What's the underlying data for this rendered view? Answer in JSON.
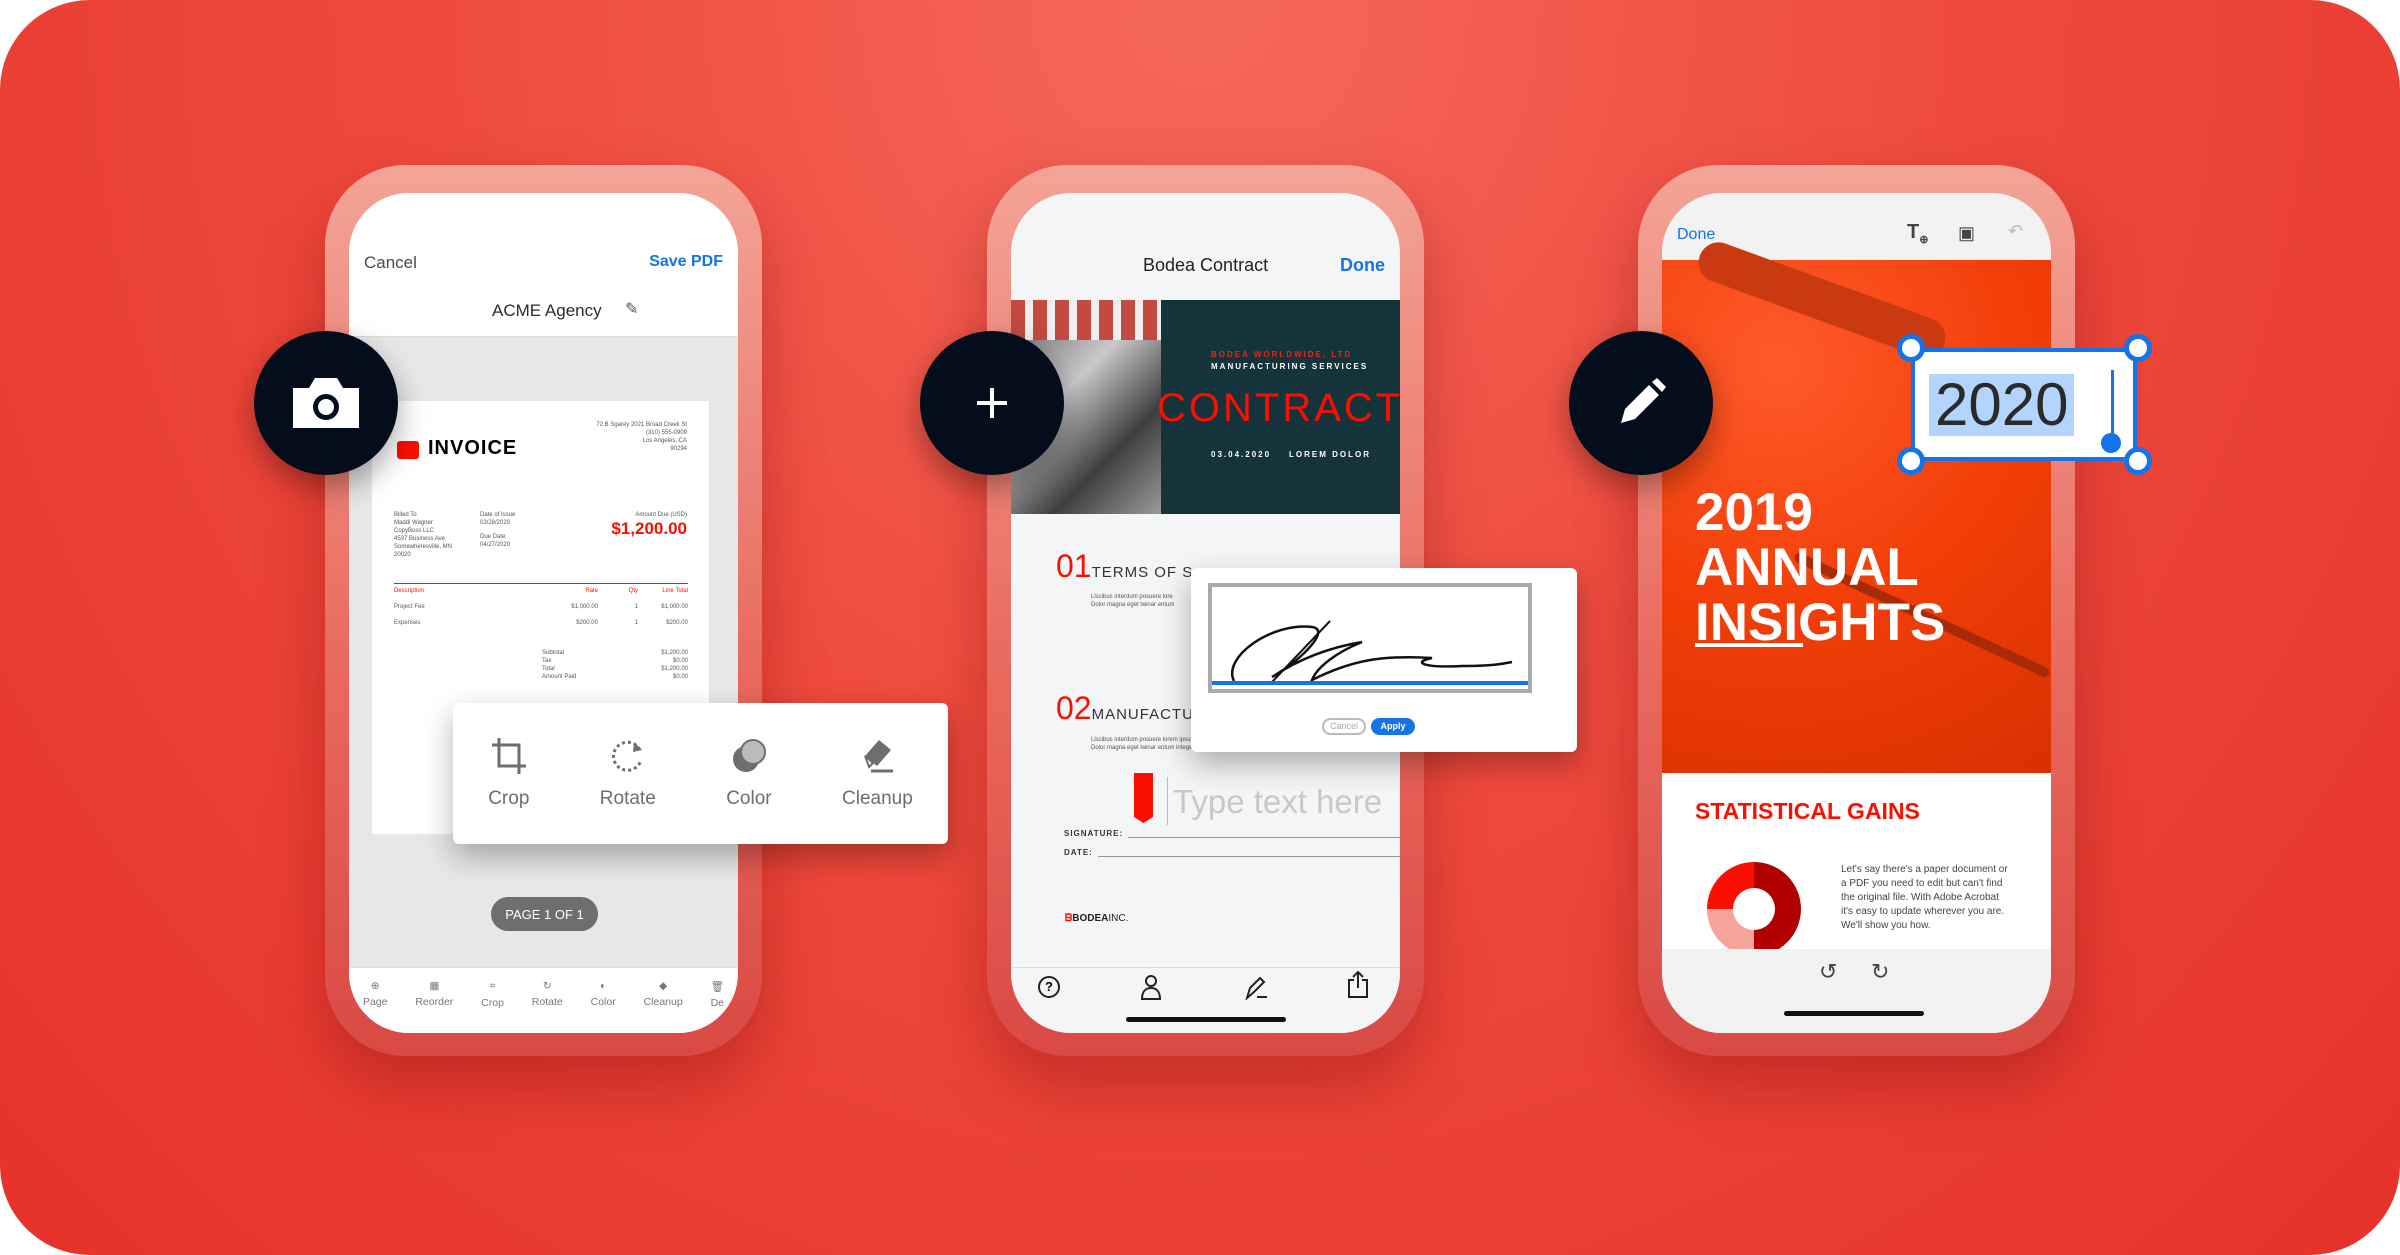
{
  "colors": {
    "background": "#ee4a3c",
    "accent_blue": "#1473e6",
    "dark_circle": "#030d1c",
    "brand_red": "#fa0f00",
    "teal": "#15333a"
  },
  "phone1": {
    "badge_icon": "camera-icon",
    "cancel": "Cancel",
    "save": "Save PDF",
    "doc_name": "ACME Agency",
    "invoice": {
      "title": "INVOICE",
      "company": "72 B Sgarey  2021 Broad Creek St",
      "phone": "(310) 555-0909",
      "city": "Los Angeles, CA",
      "zip": "90294",
      "billed_to_label": "Billed To",
      "billed_to": [
        "Maddi Wagner",
        "CopyBoss LLC",
        "4537 Business Ave",
        "Somewheresville, MN",
        "20020"
      ],
      "issue_label": "Date of Issue",
      "issue_date": "03/28/2020",
      "due_label": "Due Date",
      "due_date": "04/27/2020",
      "amount_label": "Amount Due (USD)",
      "amount": "$1,200.00",
      "columns": [
        "Description",
        "Rate",
        "Qty",
        "Line Total"
      ],
      "rows": [
        [
          "Project Fee",
          "$1,000.00",
          "1",
          "$1,000.00"
        ],
        [
          "Expenses",
          "$200.00",
          "1",
          "$200.00"
        ]
      ],
      "totals": [
        [
          "Subtotal",
          "$1,200.00"
        ],
        [
          "Tax",
          "$0.00"
        ],
        [
          "Total",
          "$1,200.00"
        ],
        [
          "Amount Paid",
          "$0.00"
        ]
      ]
    },
    "toolbar": [
      {
        "label": "Crop",
        "icon": "crop-icon"
      },
      {
        "label": "Rotate",
        "icon": "rotate-icon"
      },
      {
        "label": "Color",
        "icon": "color-icon"
      },
      {
        "label": "Cleanup",
        "icon": "eraser-icon"
      }
    ],
    "page_indicator": "PAGE 1 OF 1",
    "bottom_bar": [
      "Page",
      "Reorder",
      "Crop",
      "Rotate",
      "Color",
      "Cleanup",
      "De"
    ]
  },
  "phone2": {
    "badge_icon": "plus-icon",
    "title": "Bodea Contract",
    "done": "Done",
    "hero": {
      "company": "BODEA WORLDWIDE, LTD",
      "subtitle": "MANUFACTURING SERVICES",
      "title": "CONTRACT",
      "date": "03.04.2020",
      "meta": "LOREM DOLOR"
    },
    "section1": {
      "num": "01",
      "title": "TERMS OF S",
      "lines": [
        "Llscibus interdum posuere lore",
        "Dolor magna eget lwinar entum"
      ]
    },
    "section2": {
      "num": "02",
      "title": "MANUFACTU",
      "lines": [
        "Llscibus interdum posuere lorem ipsum dolor. Hac mauris vitae ultricies nec integer mique.",
        "Dolor magna eget lwinar entum integer."
      ]
    },
    "signature_dialog": {
      "cancel": "Cancel",
      "apply": "Apply"
    },
    "type_placeholder": "Type text here",
    "signature_label": "SIGNATURE:",
    "date_label": "DATE:",
    "brand": "BODEA",
    "brand_suffix": "INC."
  },
  "phone3": {
    "badge_icon": "pencil-icon",
    "done": "Done",
    "edit_value": "2020",
    "headline": [
      "2019",
      "ANNUAL",
      "INSIGHTS"
    ],
    "section_title": "STATISTICAL GAINS",
    "body": "Let's say there's a paper document or a PDF you need to edit but can't find the original file. With Adobe Acrobat it's easy to update wherever you are. We'll show you how."
  }
}
